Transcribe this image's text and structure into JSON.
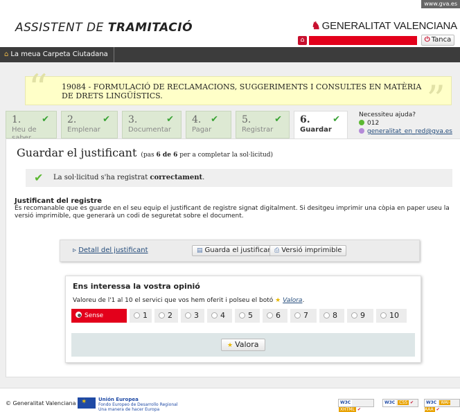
{
  "topbar": {
    "url_text": "www.gva.es"
  },
  "header": {
    "app_title_prefix": "ASSISTENT DE ",
    "app_title_bold": "TRAMITACIÓ",
    "logo_text": "GENERALITAT VALENCIANA",
    "logout_label": "Tanca"
  },
  "nav": {
    "home_label": "La meua Carpeta Ciutadana"
  },
  "procedure": {
    "title": "19084 - FORMULACIÓ DE RECLAMACIONS, SUGGERIMENTS I CONSULTES EN MATÈRIA DE DRETS LINGÜÍSTICS."
  },
  "steps": [
    {
      "num": "1.",
      "label": "Heu de saber",
      "done": true
    },
    {
      "num": "2.",
      "label": "Emplenar",
      "done": true
    },
    {
      "num": "3.",
      "label": "Documentar",
      "done": true
    },
    {
      "num": "4.",
      "label": "Pagar",
      "done": true
    },
    {
      "num": "5.",
      "label": "Registrar",
      "done": true
    },
    {
      "num": "6.",
      "label": "Guardar",
      "done": true,
      "active": true
    }
  ],
  "help": {
    "title": "Necessiteu ajuda?",
    "phone": "012",
    "email": "generalitat_en_red@gva.es"
  },
  "page": {
    "heading": "Guardar el justificant",
    "pas_prefix": "(pas ",
    "pas_bold": "6 de 6",
    "pas_suffix": " per a completar la sol·licitud)",
    "success_prefix": "La sol·licitud s'ha registrat ",
    "success_bold": "correctament",
    "success_suffix": ".",
    "section_title": "Justificant del registre",
    "section_text": "És recomanable que es guarde en el seu equip el justificant de registre signat digitalment. Si desitgeu imprimir una còpia en paper useu la versió imprimible, que generarà un codi de seguretat sobre el document."
  },
  "actions": {
    "detail_link": "Detall del justificant",
    "save_button": "Guarda el justificant",
    "print_button": "Versió imprimible"
  },
  "feedback": {
    "title": "Ens interessa la vostra opinió",
    "prompt_prefix": "Valoreu de l'1 al 10 el servici que vos hem oferit i polseu el botó ",
    "prompt_link": "Valora",
    "prompt_suffix": ".",
    "options": [
      "Sense valorar",
      "1",
      "2",
      "3",
      "4",
      "5",
      "6",
      "7",
      "8",
      "9",
      "10"
    ],
    "selected": "Sense valorar",
    "submit_label": "Valora"
  },
  "footer": {
    "copyright": "© Generalitat Valenciana",
    "eu_title": "Unión Europea",
    "eu_line1": "Fondo Europeo de Desarrollo Regional",
    "eu_line2": "Una manera de hacer Europa",
    "badges": [
      "XHTML",
      "CSS",
      "WAI-AAA"
    ],
    "badge_prefix": "W3C"
  },
  "colors": {
    "accent_red": "#e3001b",
    "step_bg": "#dde9d3",
    "check_green": "#3aa335"
  }
}
